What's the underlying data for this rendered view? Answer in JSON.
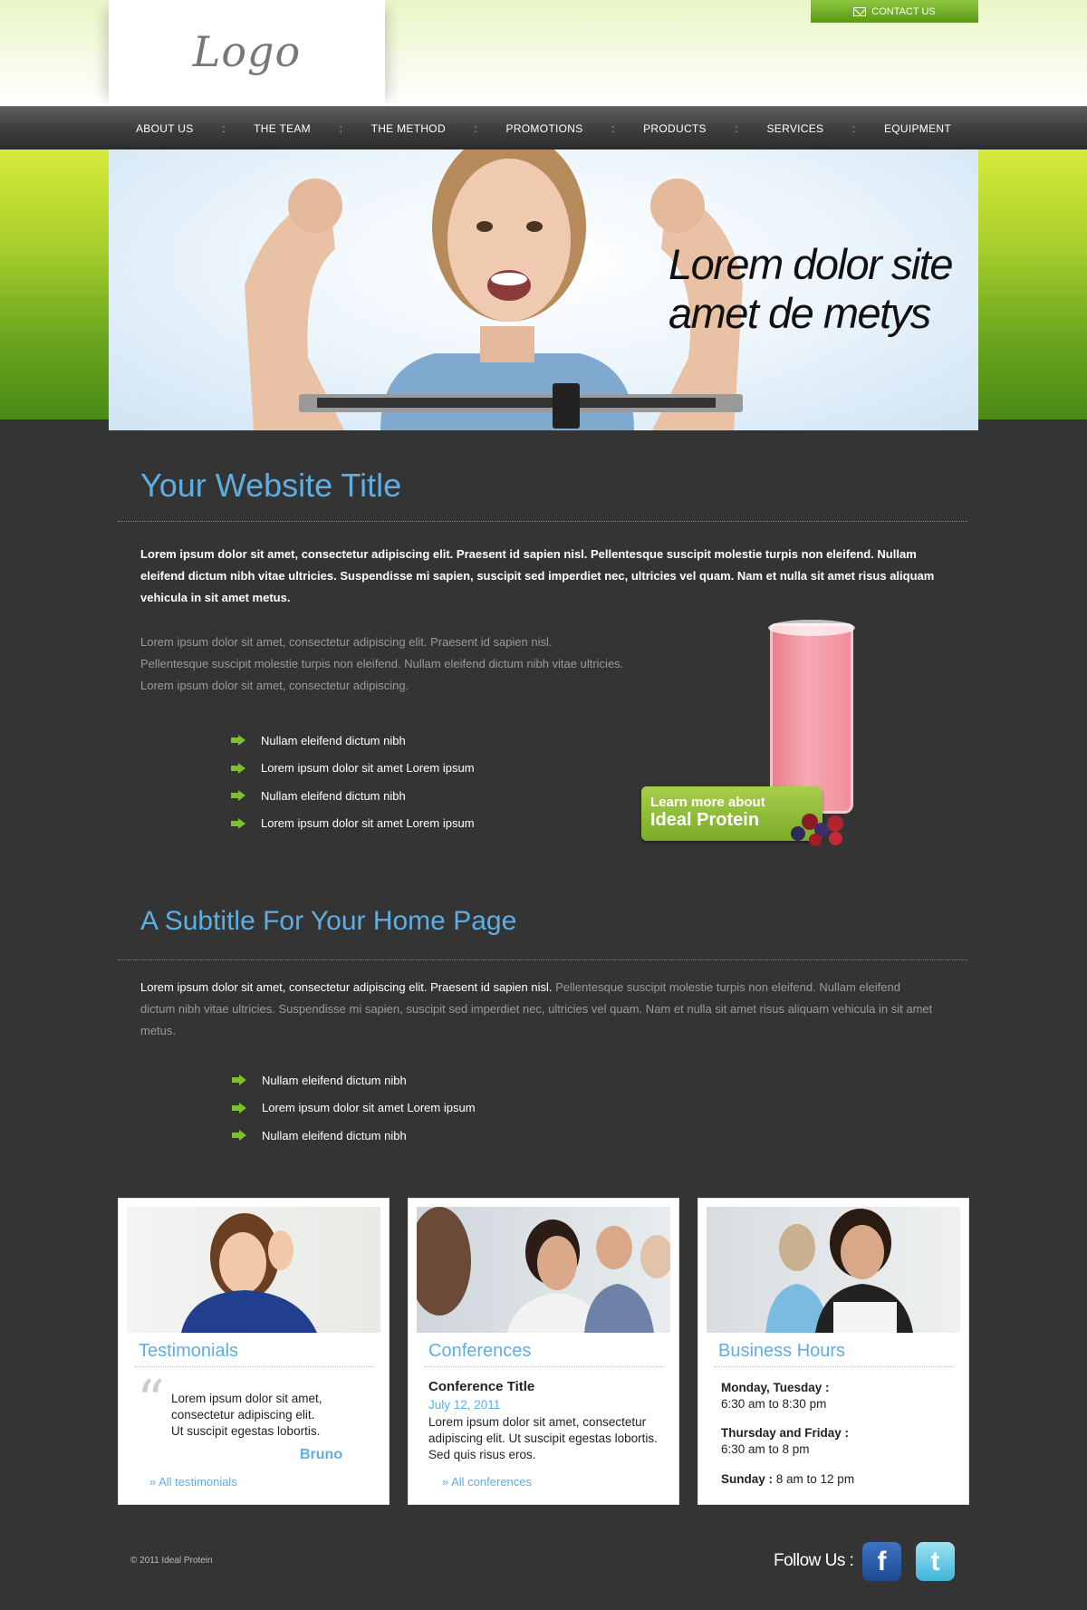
{
  "header": {
    "logo": "Logo",
    "contact_label": "CONTACT US"
  },
  "nav": {
    "items": [
      "ABOUT US",
      "THE TEAM",
      "THE METHOD",
      "PROMOTIONS",
      "PRODUCTS",
      "SERVICES",
      "EQUIPMENT"
    ],
    "separator": ":"
  },
  "hero": {
    "line1": "Lorem dolor site",
    "line2": "amet de metys"
  },
  "main": {
    "title": "Your Website Title",
    "intro_bold": "Lorem ipsum dolor sit amet, consectetur adipiscing elit. Praesent id sapien nisl. Pellentesque suscipit molestie turpis non eleifend. Nullam eleifend dictum nibh vitae ultricies. Suspendisse mi sapien, suscipit sed imperdiet nec, ultricies vel quam. Nam et nulla sit amet risus aliquam vehicula in sit amet metus.",
    "intro_gray_lines": [
      "Lorem ipsum dolor sit amet, consectetur adipiscing elit. Praesent id sapien nisl.",
      "Pellentesque suscipit molestie turpis non eleifend. Nullam eleifend dictum nibh vitae ultricies.",
      "Lorem ipsum dolor sit amet, consectetur adipiscing."
    ],
    "bullets": [
      "Nullam eleifend dictum nibh",
      "Lorem ipsum dolor sit amet Lorem ipsum",
      "Nullam eleifend dictum nibh",
      "Lorem ipsum dolor sit amet Lorem ipsum"
    ],
    "promo": {
      "line1": "Learn more about",
      "line2": "Ideal Protein"
    },
    "subtitle": "A Subtitle For Your Home Page",
    "sub_para_white": "Lorem ipsum dolor sit amet, consectetur adipiscing elit. Praesent id sapien nisl.",
    "sub_para_gray": " Pellentesque suscipit molestie turpis non eleifend. Nullam eleifend dictum nibh vitae ultricies. Suspendisse mi sapien, suscipit sed imperdiet nec, ultricies vel quam. Nam et nulla sit amet risus aliquam vehicula in sit amet metus.",
    "sub_bullets": [
      "Nullam eleifend dictum nibh",
      "Lorem ipsum dolor sit amet Lorem ipsum",
      "Nullam eleifend dictum nibh"
    ]
  },
  "cards": {
    "testimonials": {
      "title": "Testimonials",
      "quote_lines": [
        "Lorem ipsum dolor sit amet,",
        "consectetur adipiscing elit.",
        "Ut suscipit egestas lobortis."
      ],
      "author": "Bruno",
      "link": "» All testimonials"
    },
    "conferences": {
      "title": "Conferences",
      "conf_title": "Conference Title",
      "date": "July 12, 2011",
      "text_lines": [
        "Lorem ipsum dolor sit amet, consectetur",
        "adipiscing elit. Ut suscipit egestas lobortis.",
        "Sed quis risus eros."
      ],
      "link": "» All conferences"
    },
    "hours": {
      "title": "Business Hours",
      "d1_label": "Monday, Tuesday :",
      "d1_time": "6:30 am to 8:30 pm",
      "d2_label": "Thursday and Friday :",
      "d2_time": "6:30 am to 8 pm",
      "d3_label": "Sunday :",
      "d3_time": " 8 am to 12 pm"
    }
  },
  "footer": {
    "copyright": "© 2011 Ideal Protein",
    "follow": "Follow Us :",
    "facebook_glyph": "f",
    "twitter_glyph": "t"
  },
  "colors": {
    "accent_blue": "#5eaee4",
    "accent_green": "#7cc22a",
    "background": "#343434"
  }
}
